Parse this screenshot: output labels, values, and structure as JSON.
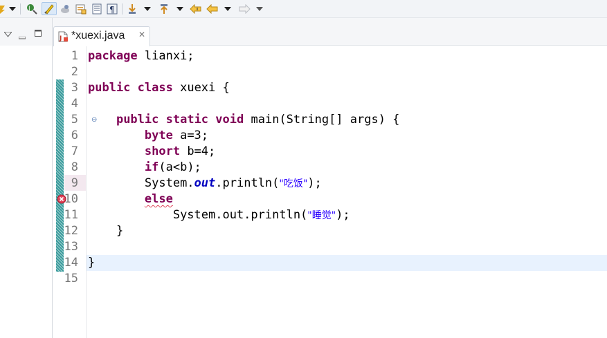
{
  "toolbar": {
    "icons": [
      "skipped-icon",
      "dropdown-arrow-icon",
      "open-type-icon",
      "toggle-mark-occurrences-icon",
      "toggle-breadcrumb-icon",
      "toggle-word-wrap-icon",
      "toggle-block-selection-icon",
      "show-whitespace-icon",
      "next-annotation-icon",
      "previous-annotation-icon",
      "last-edit-location-icon",
      "back-icon",
      "forward-icon"
    ]
  },
  "left_view": {
    "controls": [
      "view-menu-icon",
      "minimize-icon",
      "maximize-icon"
    ]
  },
  "editor_tab": {
    "label": "*xuexi.java",
    "close_glyph": "✕",
    "icon": "java-file-icon"
  },
  "editor": {
    "line_numbers": [
      "1",
      "2",
      "3",
      "4",
      "5",
      "6",
      "7",
      "8",
      "9",
      "10",
      "11",
      "12",
      "13",
      "14",
      "15"
    ],
    "current_line": 14,
    "error_line": 10,
    "code": {
      "l1_kw": "package",
      "l1_rest": " lianxi;",
      "l3_kw1": "public",
      "l3_kw2": "class",
      "l3_rest": " xuexi {",
      "l5_kw1": "public",
      "l5_kw2": "static",
      "l5_kw3": "void",
      "l5_rest": " main(String[] args) {",
      "l6_kw": "byte",
      "l6_rest": " a=3;",
      "l7_kw": "short",
      "l7_rest": " b=4;",
      "l8_kw": "if",
      "l8_rest": "(a<b);",
      "l9_pre": "System.",
      "l9_field": "out",
      "l9_mid": ".println(",
      "l9_str": "\"吃饭\"",
      "l9_end": ");",
      "l10_kw": "else",
      "l11_pre": "System.out.println(",
      "l11_str": "\"睡觉\"",
      "l11_end": ");",
      "l12": "}",
      "l14": "}"
    }
  },
  "colors": {
    "keyword": "#7f0055",
    "string": "#2a00ff",
    "field": "#0000c0",
    "error": "#e0455a",
    "current_line_bg": "#e8f2fe",
    "changed_line_bg": "#f3e8ef",
    "change_bar": "#3a9b9c"
  }
}
